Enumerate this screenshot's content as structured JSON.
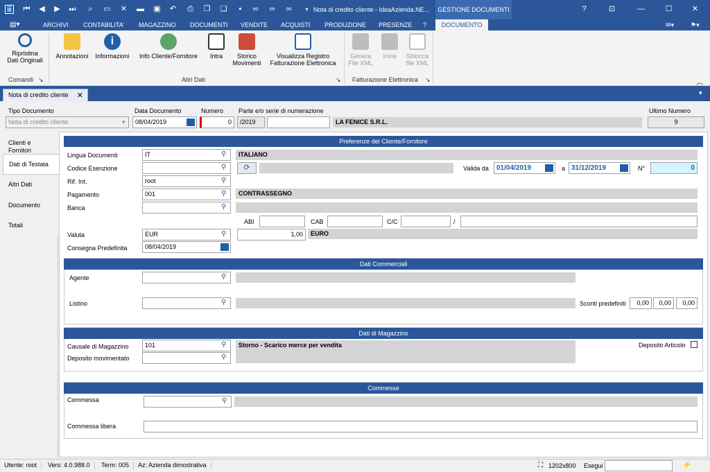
{
  "window": {
    "title": "Nota di credito cliente - IdeaAzienda.NE...",
    "context_tab": "GESTIONE DOCUMENTI"
  },
  "menu": [
    "ARCHIVI",
    "CONTABILITA'",
    "MAGAZZINO",
    "DOCUMENTI",
    "VENDITE",
    "ACQUISTI",
    "PRODUZIONE",
    "PRESENZE",
    "?",
    "DOCUMENTO"
  ],
  "ribbon": {
    "ripristina": "Ripristina Dati Originali",
    "annotazioni": "Annotazioni",
    "informazioni": "Informazioni",
    "info_cliente": "Info Cliente/Fornitore",
    "intra": "Intra",
    "storico": "Storico Movimenti",
    "visualizza": "Visualizza Registro Fatturazione Elettronica",
    "genera": "Genera File XML",
    "invia": "Invia",
    "sblocca": "Sblocca file XML",
    "grp_comandi": "Comandi",
    "grp_altri": "Altri Dati",
    "grp_fatt": "Fatturazione Elettronica"
  },
  "doc_tab": "Nota di credito cliente",
  "header": {
    "tipo_label": "Tipo Documento",
    "tipo_value": "Nota di credito cliente",
    "data_label": "Data Documento",
    "data_value": "08/04/2019",
    "numero_label": "Numero",
    "numero_value": "0",
    "serie_label": "Parte e/o serie di numerazione",
    "serie_value": "/2019",
    "company": "LA FENICE S.R.L.",
    "ultimo_label": "Ultimo Numero",
    "ultimo_value": "9"
  },
  "side": [
    "Clienti e Fornitori",
    "Dati di Testata",
    "Altri Dati",
    "Documento",
    "Totali"
  ],
  "pref": {
    "title": "Preferenze del Cliente/Fornitore",
    "lingua_label": "Lingua Documenti",
    "lingua_value": "IT",
    "lingua_desc": "ITALIANO",
    "esenzione_label": "Codice Esenzione",
    "valida_label": "Valida da",
    "valida_da": "01/04/2019",
    "a_label": "a",
    "valida_a": "31/12/2019",
    "n_label": "N°",
    "n_value": "0",
    "rif_label": "Rif. Int.",
    "rif_value": "root",
    "pag_label": "Pagamento",
    "pag_value": "001",
    "pag_desc": "CONTRASSEGNO",
    "banca_label": "Banca",
    "abi_label": "ABI",
    "cab_label": "CAB",
    "cc_label": "C/C",
    "slash": "/",
    "valuta_label": "Valuta",
    "valuta_value": "EUR",
    "cambio": "1,00",
    "valuta_desc": "EURO",
    "consegna_label": "Consegna Predefinita",
    "consegna_value": "08/04/2019"
  },
  "comm": {
    "title": "Dati Commerciali",
    "agente_label": "Agente",
    "listino_label": "Listino",
    "sconti_label": "Sconti predefiniti",
    "sconti": [
      "0,00",
      "0,00",
      "0,00"
    ]
  },
  "mag": {
    "title": "Dati di Magazzino",
    "causale_label": "Causale di Magazzino",
    "causale_value": "101",
    "causale_desc": "Storno - Scarico merce per vendita",
    "deposito_label": "Deposito movimentato",
    "deposito_art_label": "Deposito Articolo"
  },
  "commesse": {
    "title": "Commesse",
    "commessa_label": "Commessa",
    "libera_label": "Commessa libera"
  },
  "status": {
    "utente": "Utente: root",
    "vers": "Vers: 4.0.988.0",
    "term": "Term: 005",
    "az": "Az: Azienda dimostrativa",
    "res": "1202x800",
    "esegui": "Esegui"
  },
  "colors": {
    "accent": "#2b579a",
    "field_blue": "#1f5fa8",
    "readonly": "#d4d4d4"
  }
}
